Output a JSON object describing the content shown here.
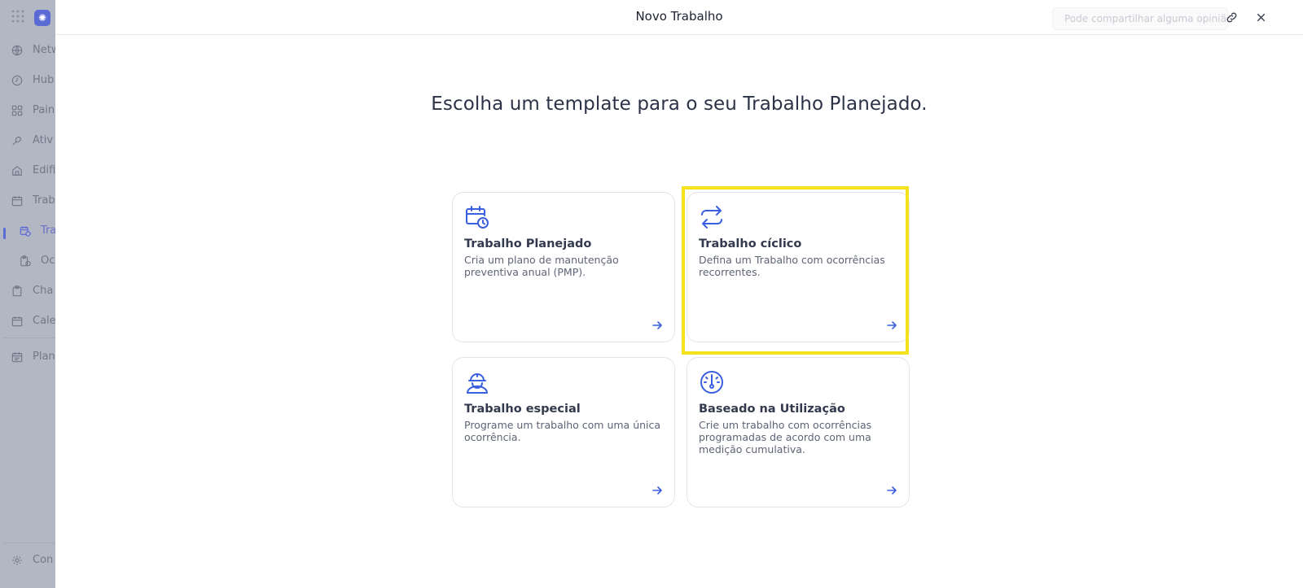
{
  "sidebar": {
    "items": [
      {
        "label": "Netw",
        "icon": "globe-icon"
      },
      {
        "label": "Hub",
        "icon": "clock-icon"
      },
      {
        "label": "Pain",
        "icon": "grid-icon"
      },
      {
        "label": "Ativ",
        "icon": "asset-icon"
      },
      {
        "label": "Edifi",
        "icon": "building-icon"
      },
      {
        "label": "Trab",
        "icon": "calendar-icon"
      },
      {
        "label": "Tra",
        "icon": "calendar-clock-icon"
      },
      {
        "label": "Oc",
        "icon": "clipboard-clock-icon"
      },
      {
        "label": "Cha",
        "icon": "clipboard-icon"
      },
      {
        "label": "Cale",
        "icon": "calendar-icon"
      },
      {
        "label": "Plan",
        "icon": "calendar-list-icon"
      },
      {
        "label": "Con",
        "icon": "gear-icon"
      }
    ]
  },
  "modal": {
    "title": "Novo Trabalho",
    "feedback_placeholder": "Pode compartilhar alguma opinião?",
    "headline": "Escolha um template para o seu Trabalho Planejado."
  },
  "cards": [
    {
      "title": "Trabalho Planejado",
      "description": "Cria um plano de manutenção preventiva anual (PMP).",
      "icon": "calendar-clock-icon"
    },
    {
      "title": "Trabalho cíclico",
      "description": "Defina um Trabalho com ocorrências recorrentes.",
      "icon": "repeat-icon"
    },
    {
      "title": "Trabalho especial",
      "description": "Programe um trabalho com uma única ocorrência.",
      "icon": "worker-icon"
    },
    {
      "title": "Baseado na Utilização",
      "description": "Crie um trabalho com ocorrências programadas de acordo com uma medição cumulativa.",
      "icon": "gauge-icon"
    }
  ],
  "colors": {
    "accent": "#3a5ee0",
    "highlight": "#f5e21a",
    "sidebar_overlay": "#b3b6c3"
  }
}
